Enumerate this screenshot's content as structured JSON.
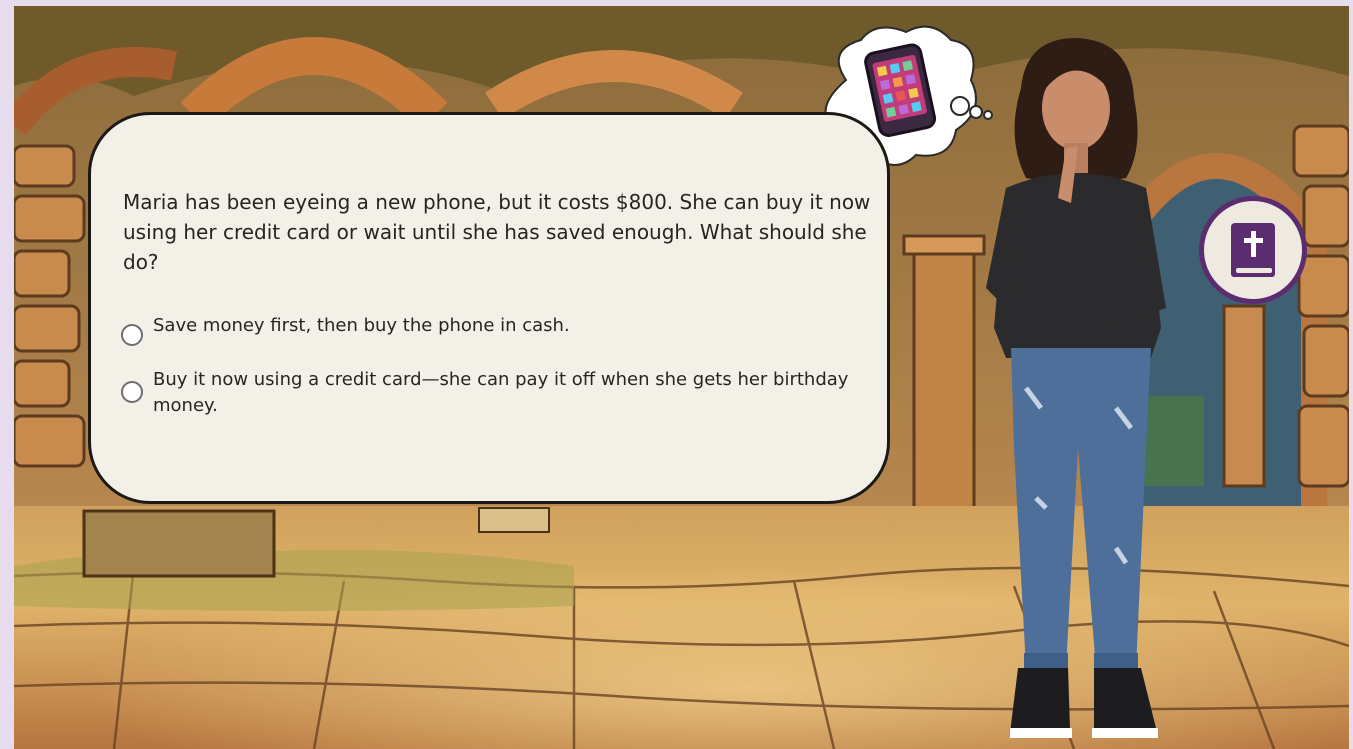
{
  "scene": {
    "question": "Maria has been eyeing a new phone, but it costs $800. She can buy it now using her credit card or wait until she has saved enough. What should she do?",
    "options": [
      {
        "label": "Save money first, then buy the phone in cash.",
        "selected": false
      },
      {
        "label": "Buy it now using a credit card—she can pay it off when she gets her birthday money.",
        "selected": false
      }
    ]
  },
  "thought_bubble": {
    "icon": "smartphone-icon"
  },
  "toolbar": {
    "book_icon": "bible-book-icon"
  },
  "character": {
    "icon": "maria-character"
  },
  "colors": {
    "dialog_bg": "#f3f1e7",
    "accent_purple": "#5b2c6f",
    "page_bg": "#e6dced",
    "stone": "#c8874a"
  }
}
